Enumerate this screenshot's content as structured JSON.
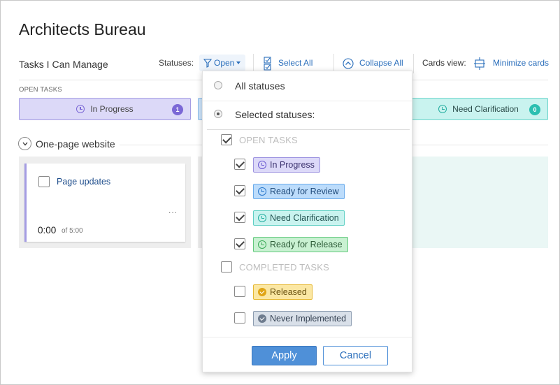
{
  "page": {
    "title": "Architects Bureau"
  },
  "toolbar": {
    "view_label": "Tasks I Can Manage",
    "statuses_label": "Statuses:",
    "open_button": "Open",
    "select_all": "Select All",
    "collapse_all": "Collapse All",
    "cards_view_label": "Cards view:",
    "minimize_cards": "Minimize cards"
  },
  "board": {
    "section_label": "OPEN TASKS",
    "columns": [
      {
        "name": "In Progress",
        "count": "1",
        "color": "#7b68d6"
      },
      {
        "name": "Need Clarification",
        "count": "0",
        "color": "#2bbfb1"
      }
    ],
    "group": {
      "title": "One-page website",
      "card": {
        "title": "Page updates",
        "time": "0:00",
        "estimate": "of 5:00",
        "more": "..."
      }
    }
  },
  "dropdown": {
    "all_statuses": "All statuses",
    "selected_statuses": "Selected statuses:",
    "open_section": "OPEN TASKS",
    "open_items": [
      "In Progress",
      "Ready for Review",
      "Need Clarification",
      "Ready for Release"
    ],
    "completed_section": "COMPLETED TASKS",
    "completed_items": [
      "Released",
      "Never Implemented"
    ],
    "apply": "Apply",
    "cancel": "Cancel"
  }
}
